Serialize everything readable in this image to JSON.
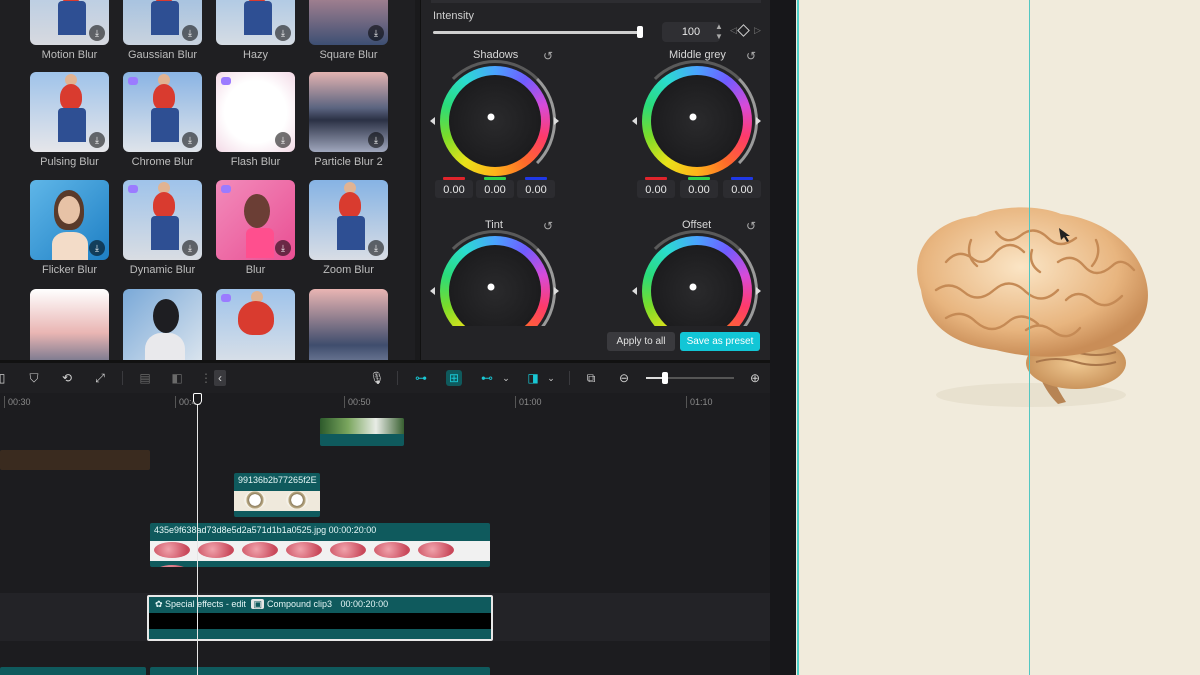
{
  "effects": [
    {
      "label": "Motion Blur"
    },
    {
      "label": "Gaussian Blur"
    },
    {
      "label": "Hazy"
    },
    {
      "label": "Square Blur"
    },
    {
      "label": "Pulsing Blur"
    },
    {
      "label": "Chrome Blur"
    },
    {
      "label": "Flash Blur"
    },
    {
      "label": "Particle Blur 2"
    },
    {
      "label": "Flicker Blur"
    },
    {
      "label": "Dynamic Blur"
    },
    {
      "label": "Blur"
    },
    {
      "label": "Zoom Blur"
    },
    {
      "label": ""
    },
    {
      "label": ""
    },
    {
      "label": ""
    },
    {
      "label": ""
    }
  ],
  "adjust": {
    "intensity_label": "Intensity",
    "intensity_value": "100",
    "intensity_level": 1.0,
    "wheels": [
      {
        "title": "Shadows",
        "r": "0.00",
        "g": "0.00",
        "b": "0.00"
      },
      {
        "title": "Middle grey",
        "r": "0.00",
        "g": "0.00",
        "b": "0.00"
      },
      {
        "title": "Tint"
      },
      {
        "title": "Offset"
      }
    ],
    "apply_all": "Apply to all",
    "save_preset": "Save as preset"
  },
  "toolbar_icons": [
    "split-icon",
    "mark-icon",
    "crop-icon",
    "transform-icon",
    "freeze-icon",
    "reverse-icon",
    "marker-icon",
    "microphone-icon",
    "link-icon",
    "magnet-icon",
    "snap-icon",
    "preview-axis-icon",
    "screenshot-icon",
    "zoom-out-icon",
    "zoom-in-icon"
  ],
  "timeline": {
    "ruler": [
      "00:30",
      "00:40",
      "00:50",
      "01:00",
      "01:10"
    ],
    "clips": {
      "clock_title": "99136b2b77265f2E",
      "brain_title": "435e9f638ad73d8e5d2a571d1b1a0525.jpg   00:00:20:00",
      "compound_title": "Special effects - edit",
      "compound_sub": "Compound clip3",
      "compound_time": "00:00:20:00"
    }
  },
  "colors": {
    "accent": "#12c6d6",
    "clip": "#0f5a5d",
    "preview_bg": "#f1ebdc"
  }
}
